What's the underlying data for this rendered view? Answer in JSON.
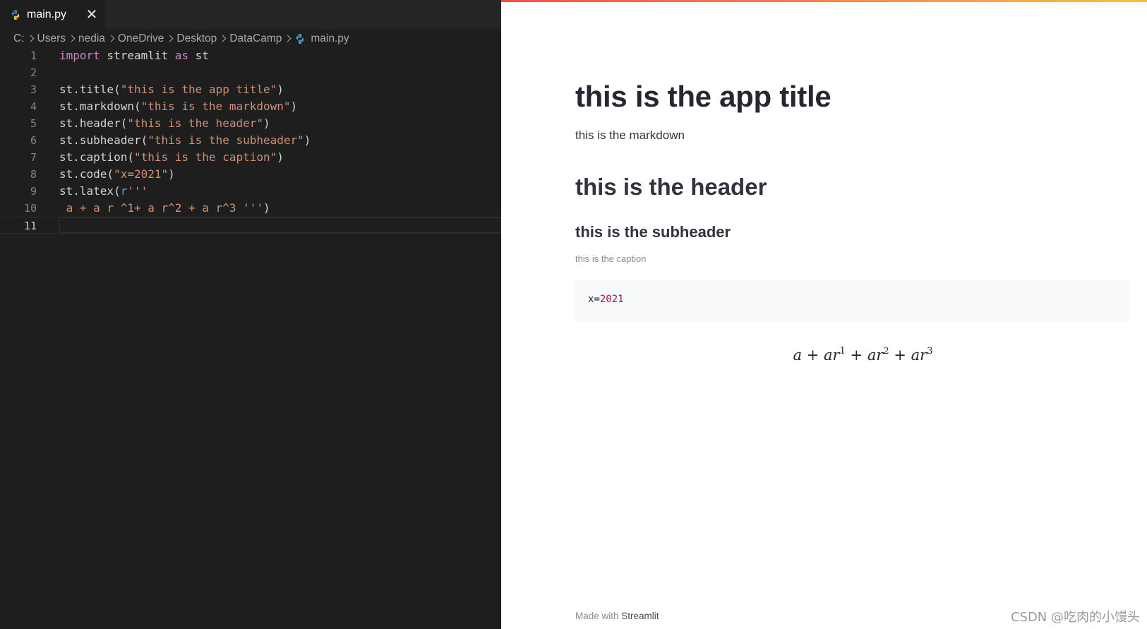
{
  "editor": {
    "tab": {
      "label": "main.py",
      "close_glyph": "✕",
      "icon": "python-icon"
    },
    "breadcrumb": {
      "items": [
        "C:",
        "Users",
        "nedia",
        "OneDrive",
        "Desktop",
        "DataCamp"
      ],
      "file": "main.py"
    },
    "lines": [
      {
        "n": "1",
        "text": "import streamlit as st"
      },
      {
        "n": "2",
        "text": ""
      },
      {
        "n": "3",
        "text": "st.title(\"this is the app title\")"
      },
      {
        "n": "4",
        "text": "st.markdown(\"this is the markdown\")"
      },
      {
        "n": "5",
        "text": "st.header(\"this is the header\")"
      },
      {
        "n": "6",
        "text": "st.subheader(\"this is the subheader\")"
      },
      {
        "n": "7",
        "text": "st.caption(\"this is the caption\")"
      },
      {
        "n": "8",
        "text": "st.code(\"x=2021\")"
      },
      {
        "n": "9",
        "text": "st.latex(r'''"
      },
      {
        "n": "10",
        "text": " a + a r ^1+ a r^2 + a r^3 ''')"
      },
      {
        "n": "11",
        "text": ""
      }
    ],
    "active_line": "11",
    "colors": {
      "background": "#1e1e1e",
      "keyword": "#c586c0",
      "string": "#ce9178",
      "raw_prefix": "#569cd6"
    }
  },
  "app": {
    "title": "this is the app title",
    "markdown": "this is the markdown",
    "header": "this is the header",
    "subheader": "this is the subheader",
    "caption": "this is the caption",
    "code": {
      "var": "x",
      "op": "=",
      "num": "2021"
    },
    "latex": {
      "terms": [
        "a",
        "+",
        "ar",
        "1",
        "+",
        "ar",
        "2",
        "+",
        "ar",
        "3"
      ]
    },
    "footer": {
      "prefix": "Made with ",
      "link": "Streamlit"
    },
    "colors": {
      "accent_start": "#ff4b4b",
      "accent_end": "#ffbd45",
      "text": "#31333f"
    }
  },
  "watermark": "CSDN @吃肉的小馒头"
}
